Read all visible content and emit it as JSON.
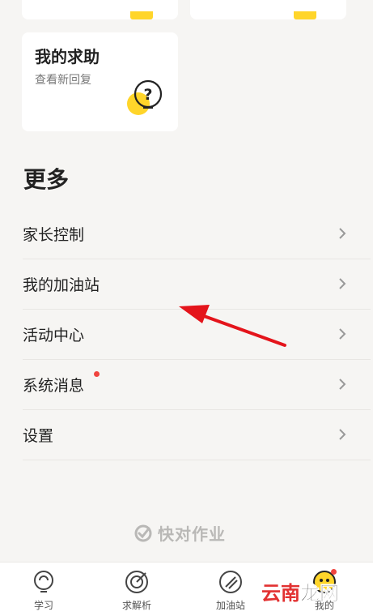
{
  "help_card": {
    "title": "我的求助",
    "subtitle": "查看新回复"
  },
  "more_section": {
    "title": "更多"
  },
  "menu_items": [
    {
      "label": "家长控制"
    },
    {
      "label": "我的加油站"
    },
    {
      "label": "活动中心"
    },
    {
      "label": "系统消息",
      "has_badge": true
    },
    {
      "label": "设置"
    }
  ],
  "brand": {
    "name": "快对作业"
  },
  "tabs": [
    {
      "label": "学习",
      "icon": "bulb-icon"
    },
    {
      "label": "求解析",
      "icon": "target-icon"
    },
    {
      "label": "加油站",
      "icon": "pencil-icon"
    },
    {
      "label": "我的",
      "icon": "profile-icon",
      "active": true
    }
  ],
  "watermark": {
    "text_red": "云南",
    "text_dark": "龙网"
  },
  "colors": {
    "accent_yellow": "#ffd52a",
    "badge_red": "#f0443e",
    "annotation_red": "#e4141b"
  }
}
